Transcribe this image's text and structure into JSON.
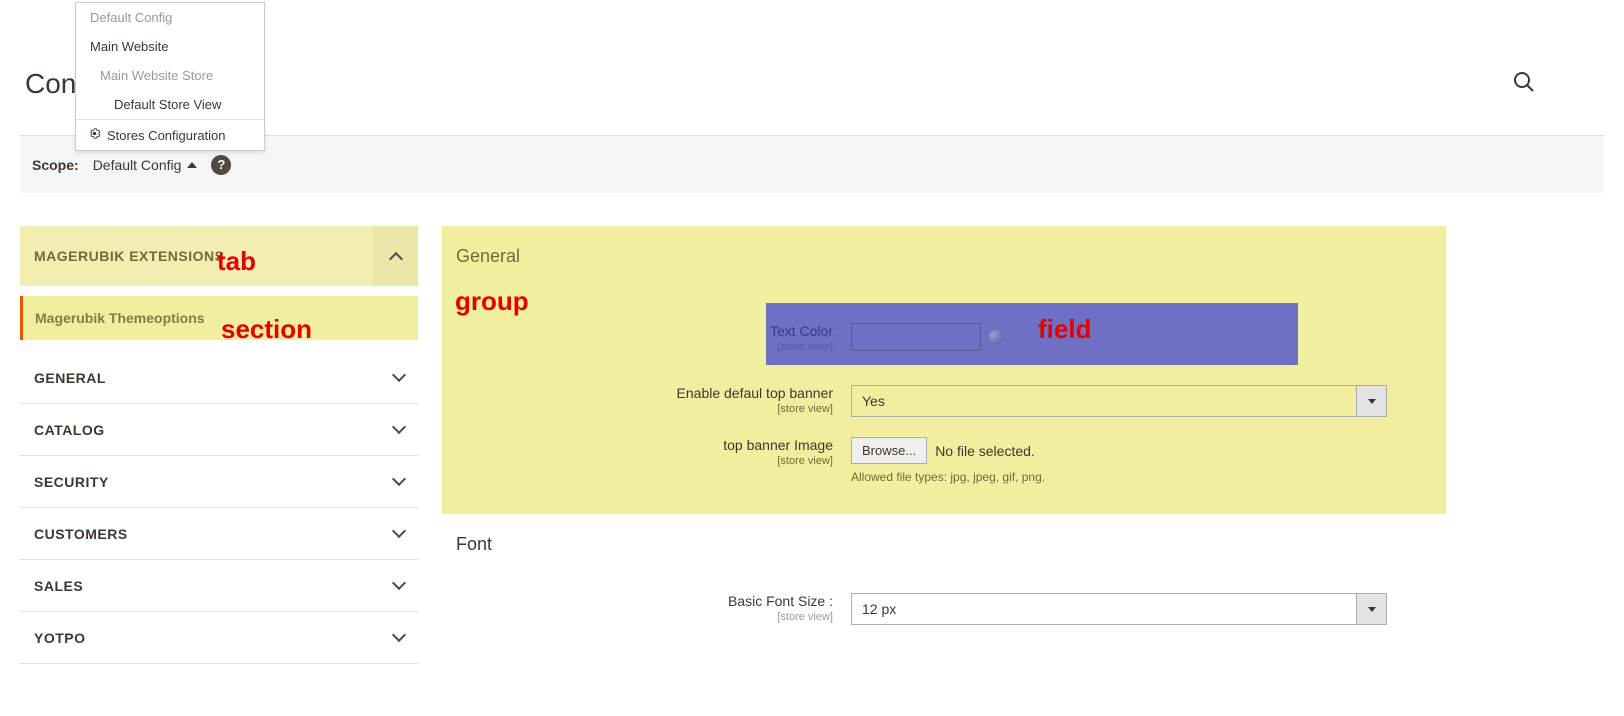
{
  "page_title": "Conf",
  "scope": {
    "label": "Scope:",
    "value": "Default Config"
  },
  "store_switcher": {
    "items": [
      {
        "label": "Default Config",
        "level": 0,
        "disabled": true
      },
      {
        "label": "Main Website",
        "level": 0,
        "disabled": false
      },
      {
        "label": "Main Website Store",
        "level": 1,
        "disabled": true
      },
      {
        "label": "Default Store View",
        "level": 2,
        "disabled": false
      }
    ],
    "stores_config_label": "Stores Configuration"
  },
  "sidebar": {
    "active_tab": "MAGERUBIK EXTENSIONS",
    "active_section": "Magerubik Themeoptions",
    "items": [
      {
        "label": "GENERAL"
      },
      {
        "label": "CATALOG"
      },
      {
        "label": "SECURITY"
      },
      {
        "label": "CUSTOMERS"
      },
      {
        "label": "SALES"
      },
      {
        "label": "YOTPO"
      }
    ]
  },
  "groups": {
    "general": {
      "title": "General",
      "fields": {
        "text_color": {
          "label": "Text Color",
          "scope": "[store view]",
          "value": ""
        },
        "enable_banner": {
          "label": "Enable defaul top banner",
          "scope": "[store view]",
          "value": "Yes"
        },
        "banner_image": {
          "label": "top banner Image",
          "scope": "[store view]",
          "button": "Browse...",
          "status": "No file selected.",
          "hint": "Allowed file types: jpg, jpeg, gif, png."
        }
      }
    },
    "font": {
      "title": "Font",
      "fields": {
        "basic_font_size": {
          "label": "Basic Font Size :",
          "scope": "[store view]",
          "value": "12 px"
        }
      }
    }
  },
  "annotations": {
    "tab": "tab",
    "section": "section",
    "group": "group",
    "field": "field"
  }
}
